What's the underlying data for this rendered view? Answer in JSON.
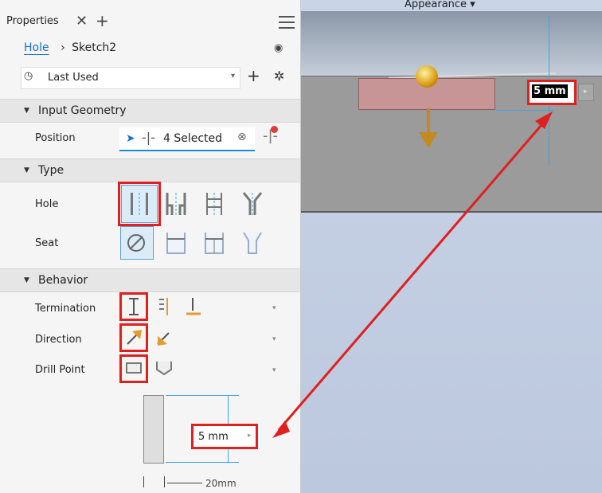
{
  "panel": {
    "tab_label": "Properties",
    "breadcrumb": {
      "feature": "Hole",
      "sketch": "Sketch2"
    },
    "preset": "Last Used",
    "sections": {
      "input_geometry": "Input Geometry",
      "type": "Type",
      "behavior": "Behavior"
    },
    "rows": {
      "position": "Position",
      "hole": "Hole",
      "seat": "Seat",
      "termination": "Termination",
      "direction": "Direction",
      "drill_point": "Drill Point"
    },
    "position_selection": "4 Selected",
    "preview": {
      "depth_value": "5 mm",
      "width_label": "20mm"
    }
  },
  "viewport": {
    "appearance_label": "Appearance",
    "depth_value": "5 mm"
  },
  "colors": {
    "highlight": "#e01f1f",
    "accent": "#1a6fc4",
    "arrow": "#e01f1f"
  }
}
